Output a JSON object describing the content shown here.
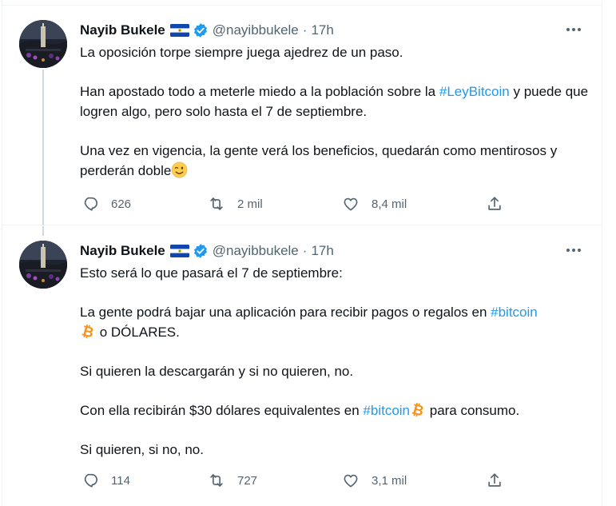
{
  "tweets": [
    {
      "author": {
        "name": "Nayib Bukele",
        "handle": "@nayibbukele",
        "flag_icon": "el-salvador-flag-icon",
        "verified_icon": "verified-badge-icon"
      },
      "separator": "·",
      "time": "17h",
      "paragraphs": {
        "p1": {
          "t1": "La oposición torpe siempre juega ajedrez de un paso."
        },
        "p2": {
          "t1": "Han apostado todo a meterle miedo a la población sobre la ",
          "tag1": "#LeyBitcoin",
          "t2": " y puede que logren algo, pero solo hasta el 7 de septiembre."
        },
        "p3": {
          "t1": "Una vez en vigencia, la gente verá los beneficios, quedarán como mentirosos y perderán doble",
          "emoji": "winking-face-emoji"
        }
      },
      "stats": {
        "replies": "626",
        "retweets": "2 mil",
        "likes": "8,4 mil"
      }
    },
    {
      "author": {
        "name": "Nayib Bukele",
        "handle": "@nayibbukele",
        "flag_icon": "el-salvador-flag-icon",
        "verified_icon": "verified-badge-icon"
      },
      "separator": "·",
      "time": "17h",
      "paragraphs": {
        "p1": {
          "t1": "Esto será lo que pasará el 7 de septiembre:"
        },
        "p2": {
          "t1": "La gente podrá bajar una aplicación para recibir pagos o regalos en ",
          "tag1": "#bitcoin",
          "icon": "bitcoin-icon",
          "t2": " o DÓLARES."
        },
        "p3": {
          "t1": "Si quieren la descargarán y si no quieren, no."
        },
        "p4": {
          "t1": "Con ella recibirán $30 dólares equivalentes en ",
          "tag1": "#bitcoin",
          "icon": "bitcoin-icon",
          "t2": " para consumo."
        },
        "p5": {
          "t1": "Si quieren, si no, no."
        }
      },
      "stats": {
        "replies": "114",
        "retweets": "727",
        "likes": "3,1 mil"
      }
    }
  ],
  "colors": {
    "text": "#0f1419",
    "secondary": "#536471",
    "hashtag": "#1d9bf0",
    "verified": "#1d9bf0",
    "bitcoin": "#f7931a",
    "divider": "#eff3f4",
    "thread_line": "#cfd9de"
  },
  "icons": {
    "more": "more-options-icon",
    "reply": "reply-icon",
    "retweet": "retweet-icon",
    "like": "heart-icon",
    "share": "share-icon"
  }
}
